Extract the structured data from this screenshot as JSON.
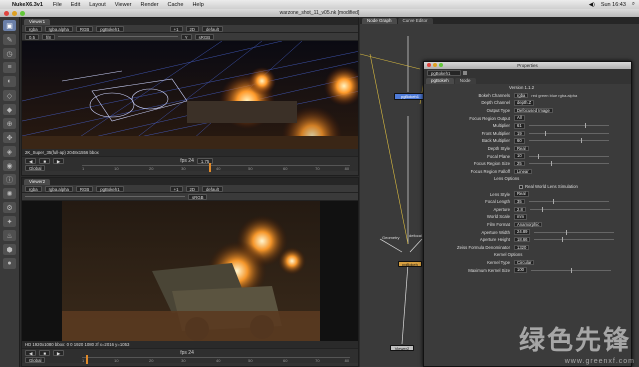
{
  "menubar": {
    "app": "NukeX6.3v1",
    "items": [
      "File",
      "Edit",
      "Layout",
      "Viewer",
      "Render",
      "Cache",
      "Help"
    ],
    "clock": "Sun 16:43"
  },
  "window": {
    "title": "warzone_shot_11_v05.nk [modified]"
  },
  "viewer1": {
    "tab": "Viewer1",
    "bar1": [
      "rgba",
      "rgba.alpha",
      "RGB",
      "pgBokeh1",
      "+1",
      "2D",
      "default",
      "sRGB"
    ],
    "bar2": [
      "0.5",
      "f/8",
      "1",
      "Y",
      "1",
      "+"
    ],
    "info": "2K_Super_35(full-ap) 2048x1556 bbox",
    "timeline": {
      "fps": "fps 24",
      "frame_field": "1.75",
      "global": "Global",
      "frame": "1",
      "ticks": [
        "1",
        "10",
        "20",
        "30",
        "40",
        "50",
        "60",
        "70",
        "80"
      ]
    }
  },
  "viewer2": {
    "tab": "Viewer2",
    "bar1": [
      "rgba",
      "rgba.alpha",
      "RGB",
      "pgBokeh1",
      "+1",
      "2D",
      "default",
      "sRGB"
    ],
    "info": "HD 1920x1080 bbox: 0 0 1920 1080 zf  x=2016 y=1053",
    "timeline": {
      "fps": "fps 24",
      "global": "Global",
      "frame": "1",
      "ticks": [
        "1",
        "10",
        "20",
        "30",
        "40",
        "50",
        "60",
        "70",
        "80"
      ]
    }
  },
  "nodegraph": {
    "tabs": [
      "Node Graph",
      "Curve Editor"
    ],
    "nodes": {
      "top": "pgBokeh1",
      "mid": "pgBokeh",
      "left_label": "Geometry",
      "right_label": "defocal",
      "bottom": "Viewer2"
    }
  },
  "properties": {
    "title": "Properties",
    "node_name": "pgBokeh1",
    "tabs": [
      "pgBokeh",
      "Node"
    ],
    "version": "Version 1.1.2",
    "rows": [
      {
        "label": "Bokeh Channels",
        "value": "rgba",
        "extra": "red  green  blue  rgba.alpha"
      },
      {
        "label": "Depth Channel",
        "value": "depth.Z"
      },
      {
        "label": "Output Type",
        "value": "Defocused Image"
      },
      {
        "label": "Focus Region Output",
        "value": "All"
      },
      {
        "label": "Multiplier",
        "value": "61"
      },
      {
        "label": "Front Multiplier",
        "value": "19"
      },
      {
        "label": "Back Multiplier",
        "value": "60"
      },
      {
        "label": "Depth Style",
        "value": "Real"
      },
      {
        "label": "Focal Plane",
        "value": "10"
      },
      {
        "label": "Focus Region Size",
        "value": "25"
      },
      {
        "label": "Focus Region Falloff",
        "value": "Linear"
      }
    ],
    "lens_options": "Lens Options",
    "real_world": "Real World Lens Simulation",
    "rows2": [
      {
        "label": "Lens Style",
        "value": "Real"
      },
      {
        "label": "Focal Length",
        "value": "35"
      },
      {
        "label": "Aperture",
        "value": "2.8"
      },
      {
        "label": "World Scale",
        "value": "mm"
      },
      {
        "label": "Film Format",
        "value": "Anamorphic"
      },
      {
        "label": "Aperture Width",
        "value": "24.89"
      },
      {
        "label": "Aperture Height",
        "value": "18.66"
      },
      {
        "label": "Zeiss Formula Denominator",
        "value": "1320"
      }
    ],
    "kernel_options": "Kernel Options",
    "rows3": [
      {
        "label": "Kernel Type",
        "value": "Circular"
      },
      {
        "label": "Maximum Kernel Size",
        "value": "100"
      }
    ]
  },
  "watermark": {
    "text": "绿色先锋",
    "url": "www.greenxf.com"
  }
}
